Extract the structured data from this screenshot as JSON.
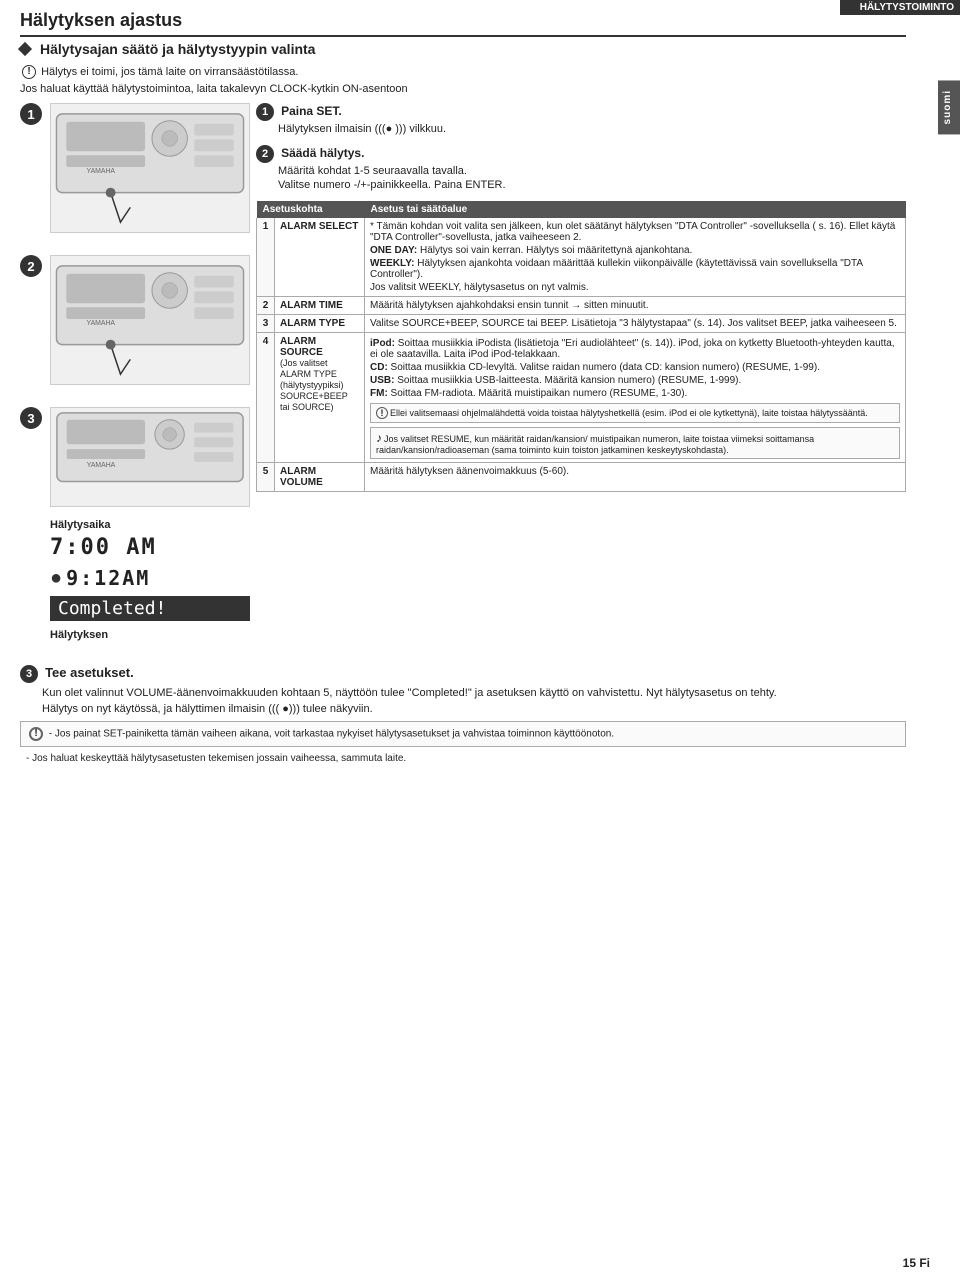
{
  "header": {
    "title": "HÄLYTYSTOIMINTO",
    "side_tab": "suomi",
    "page_number": "15 Fi"
  },
  "page_title": "Hälytyksen ajastus",
  "subtitle": "Hälytysajan säätö ja hälytystyypin valinta",
  "warning_intro": "Hälytys ei toimi, jos tämä laite on virransäästötilassa.",
  "intro_text": "Jos haluat käyttää hälytystoimintoa, laita takalevyn CLOCK-kytkin ON-asentoon",
  "steps": {
    "step1_label": "Paina SET.",
    "step1_detail": "Hälytyksen ilmaisin (((● ))) vilkkuu.",
    "step2_label": "Säädä hälytys.",
    "step2_detail1": "Määritä kohdat 1-5 seuraavalla tavalla.",
    "step2_detail2": "Valitse numero -/+-painikkeella. Paina ENTER.",
    "step3_label": "Tee asetukset.",
    "step3_detail1": "Kun olet valinnut VOLUME-äänenvoimakkuuden kohtaan 5, näyttöön tulee \"Completed!\" ja asetuksen käyttö on vahvistettu. Nyt hälytysasetus on tehty.",
    "step3_detail2": "Hälytys on nyt käytössä, ja hälyttimen ilmaisin ((( ●))) tulee näkyviin."
  },
  "table": {
    "col1": "Asetuskohta",
    "col2": "Asetus tai säätöalue",
    "rows": [
      {
        "num": "1",
        "name": "ALARM SELECT",
        "desc": "* Tämän kohdan voit valita sen jälkeen, kun olet säätänyt hälytyksen \"DTA Controller\" -sovelluksella ( s. 16). Ellet käytä \"DTA Controller\"-sovellusta, jatka vaiheeseen 2.",
        "sub": [
          {
            "label": "ONE DAY:",
            "text": "Hälytys soi vain kerran. Hälytys soi määritettynä ajankohtana."
          },
          {
            "label": "WEEKLY:",
            "text": "Hälytyksen ajankohta voidaan määrittää kullekin viikonpäivälle (käytettävissä vain sovelluksella \"DTA Controller\")."
          },
          {
            "label": "",
            "text": "Jos valitsit WEEKLY, hälytysasetus on nyt valmis."
          }
        ]
      },
      {
        "num": "2",
        "name": "ALARM TIME",
        "desc": "Määritä hälytyksen ajahkohdaksi ensin tunnit → sitten minuutit.",
        "sub": []
      },
      {
        "num": "3",
        "name": "ALARM TYPE",
        "desc": "Valitse SOURCE+BEEP, SOURCE tai BEEP. Lisätietoja \"3 hälytystapaa\" (s. 14). Jos valitset BEEP, jatka vaiheeseen 5.",
        "sub": []
      },
      {
        "num": "4",
        "name": "ALARM SOURCE",
        "name2": "(Jos valitset ALARM TYPE (hälytystyypiksi) SOURCE+BEEP tai SOURCE)",
        "desc": "",
        "sub": [
          {
            "label": "iPod:",
            "text": "Soittaa musiikkia iPodista (lisätietoja \"Eri audiolähteet\" (s. 14)). iPod, joka on kytketty Bluetooth-yhteyden kautta, ei ole saatavilla. Laita iPod iPod-telakkaan."
          },
          {
            "label": "CD:",
            "text": "Soittaa musiikkia CD-levyltä. Valitse raidan numero (data CD: kansion numero) (RESUME, 1-99)."
          },
          {
            "label": "USB:",
            "text": "Soittaa musiikkia USB-laitteesta. Määritä kansion numero) (RESUME, 1-999)."
          },
          {
            "label": "FM:",
            "text": "Soittaa FM-radiota. Määritä muistipaikan numero (RESUME, 1-30)."
          }
        ]
      },
      {
        "num": "5",
        "name": "ALARM VOLUME",
        "desc": "Määritä hälytyksen äänenvoimakkuus (5-60).",
        "sub": []
      }
    ]
  },
  "note_box1": {
    "icon": "!",
    "text": "Ellei valitsemaasi ohjelmalähdettä voida toistaa hälytyshetkellä (esim. iPod ei ole kytkettynä), laite toistaa hälytyssääntä."
  },
  "note_box2": {
    "icon": "♪",
    "text": "Jos valitset RESUME, kun määrität raidan/kansion/ muistipaikan numeron, laite toistaa viimeksi soittamansa raidan/kansion/radioaseman (sama toiminto kuin toiston jatkaminen keskeytyskohdasta)."
  },
  "note_bottom1": {
    "icon": "!",
    "text": "- Jos painat SET-painiketta tämän vaiheen aikana, voit tarkastaa nykyiset hälytysasetukset ja vahvistaa toiminnon käyttöönoton."
  },
  "note_bottom2": {
    "text": "- Jos haluat keskeyttää hälytysasetusten tekemisen jossain vaiheessa, sammuta laite."
  },
  "alarm_time_section": {
    "label": "Hälytysaika",
    "time_display": "7:00 AM",
    "time_display2": "9:12AM",
    "completed": "Completed!",
    "halytyksen": "Hälytyksen"
  }
}
